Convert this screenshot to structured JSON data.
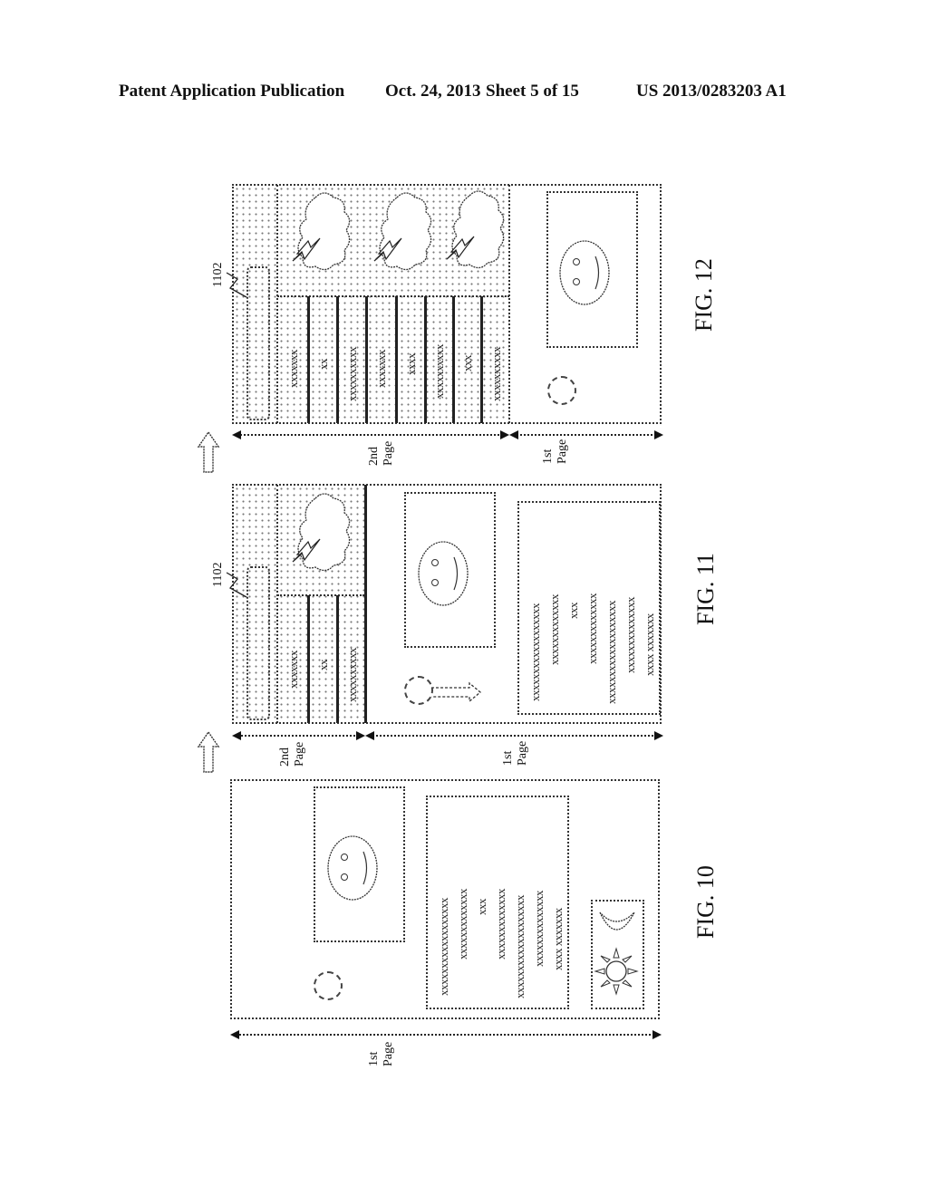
{
  "header": {
    "publication": "Patent Application Publication",
    "date": "Oct. 24, 2013",
    "sheet": "Sheet 5 of 15",
    "number": "US 2013/0283203 A1"
  },
  "figures": {
    "fig12": {
      "label": "FIG. 12",
      "ref": "1102",
      "second_page_label": [
        "2nd",
        "Page"
      ],
      "first_page_label": [
        "1st",
        "Page"
      ],
      "list_items": [
        "xxxxxxx",
        "xx",
        "xxxxxxxxxx",
        "xxxxxxx",
        "xxxx",
        "xxxxxxxxxx",
        "xxx",
        "xxxxxxxxxx"
      ],
      "cloud_icons": 3
    },
    "fig11": {
      "label": "FIG. 11",
      "ref": "1102",
      "second_page_label": [
        "2nd",
        "Page"
      ],
      "first_page_label": [
        "1st",
        "Page"
      ],
      "list_items": [
        "xxxxxxx",
        "xx",
        "xxxxxxxxxx"
      ],
      "text_lines": [
        "xxxxxxxxxxxxxxxxxx",
        "xxxxxxxxxxxxx",
        "xxx",
        "xxxxxxxxxxxxx",
        "xxxxxxxxxxxxxxxxxxx",
        "xxxxxxxxxxxxxx",
        "xxxx      xxxxxxx"
      ]
    },
    "fig10": {
      "label": "FIG. 10",
      "first_page_label": [
        "1st",
        "Page"
      ],
      "text_lines": [
        "xxxxxxxxxxxxxxxxxx",
        "xxxxxxxxxxxxx",
        "xxx",
        "xxxxxxxxxxxxx",
        "xxxxxxxxxxxxxxxxxxx",
        "xxxxxxxxxxxxxx",
        "xxxx      xxxxxxx"
      ]
    }
  }
}
